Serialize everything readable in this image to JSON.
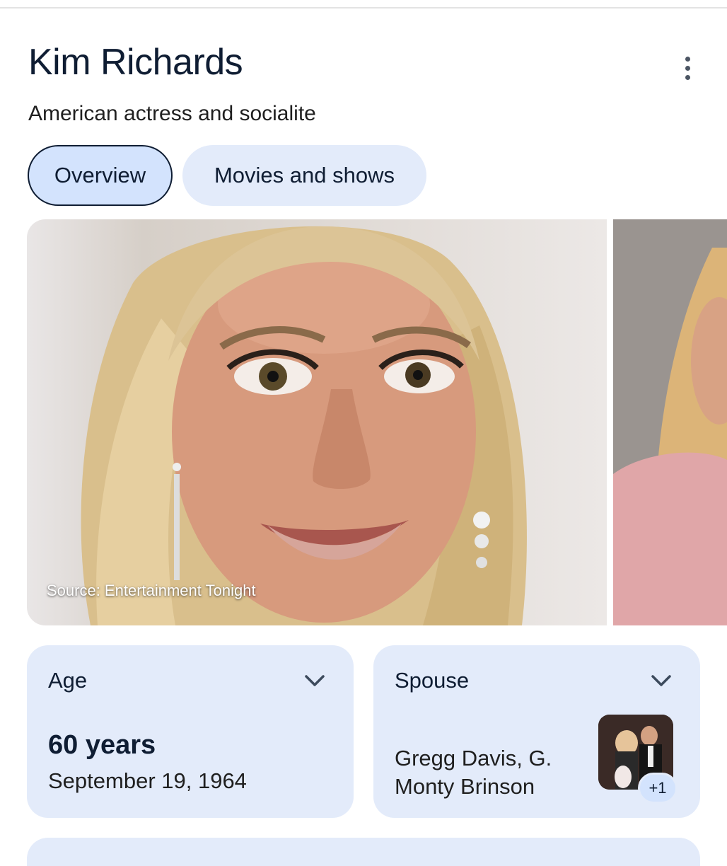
{
  "header": {
    "title": "Kim Richards",
    "subtitle": "American actress and socialite"
  },
  "tabs": [
    {
      "label": "Overview",
      "active": true
    },
    {
      "label": "Movies and shows",
      "active": false
    }
  ],
  "images": {
    "main_source": "Source: Entertainment Tonight"
  },
  "cards": {
    "age": {
      "label": "Age",
      "value": "60 years",
      "detail": "September 19, 1964"
    },
    "spouse": {
      "label": "Spouse",
      "value": "Gregg Davis, G. Monty Brinson",
      "extra_count": "+1"
    }
  },
  "colors": {
    "chip_active_bg": "#d3e3fd",
    "card_bg": "#e3ebfa",
    "title_color": "#0f1d33"
  },
  "icons": [
    "more-vert-icon",
    "chevron-down-icon"
  ]
}
